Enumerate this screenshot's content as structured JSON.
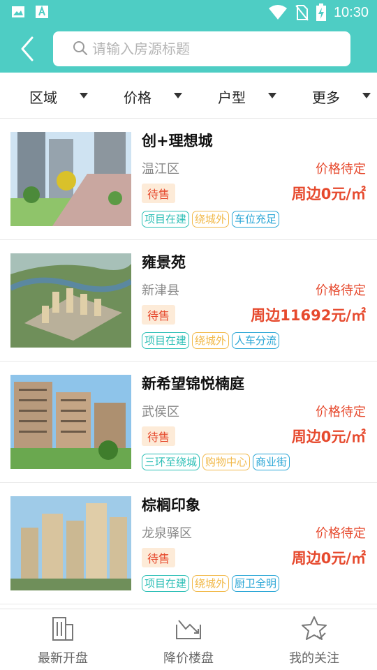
{
  "status_bar": {
    "time": "10:30",
    "colors": {
      "bg": "#4ecdc4"
    },
    "icons": [
      "image-icon",
      "text-icon",
      "wifi-icon",
      "no-sim-icon",
      "battery-charging-icon"
    ]
  },
  "header": {
    "back_icon": "chevron-left-icon",
    "search": {
      "placeholder": "请输入房源标题",
      "value": ""
    }
  },
  "filters": [
    {
      "label": "区域"
    },
    {
      "label": "价格"
    },
    {
      "label": "户型"
    },
    {
      "label": "更多"
    }
  ],
  "listings": [
    {
      "title": "创+理想城",
      "district": "温江区",
      "price_status": "价格待定",
      "badge": "待售",
      "price": "周边0元/㎡",
      "tags": [
        "项目在建",
        "绕城外",
        "车位充足"
      ]
    },
    {
      "title": "雍景苑",
      "district": "新津县",
      "price_status": "价格待定",
      "badge": "待售",
      "price": "周边11692元/㎡",
      "tags": [
        "项目在建",
        "绕城外",
        "人车分流"
      ]
    },
    {
      "title": "新希望锦悦楠庭",
      "district": "武侯区",
      "price_status": "价格待定",
      "badge": "待售",
      "price": "周边0元/㎡",
      "tags": [
        "三环至绕城",
        "购物中心",
        "商业街"
      ]
    },
    {
      "title": "棕榈印象",
      "district": "龙泉驿区",
      "price_status": "价格待定",
      "badge": "待售",
      "price": "周边0元/㎡",
      "tags": [
        "项目在建",
        "绕城外",
        "厨卫全明"
      ]
    }
  ],
  "bottom_nav": [
    {
      "label": "最新开盘",
      "icon": "building-icon"
    },
    {
      "label": "降价楼盘",
      "icon": "price-drop-icon"
    },
    {
      "label": "我的关注",
      "icon": "star-check-icon"
    }
  ],
  "colors": {
    "accent": "#4ecdc4",
    "price": "#e6492d",
    "badge_bg": "#fdebd8",
    "tag_teal": "#2cbfb6",
    "tag_yellow": "#f2b94a",
    "tag_blue": "#2aa6d6"
  }
}
